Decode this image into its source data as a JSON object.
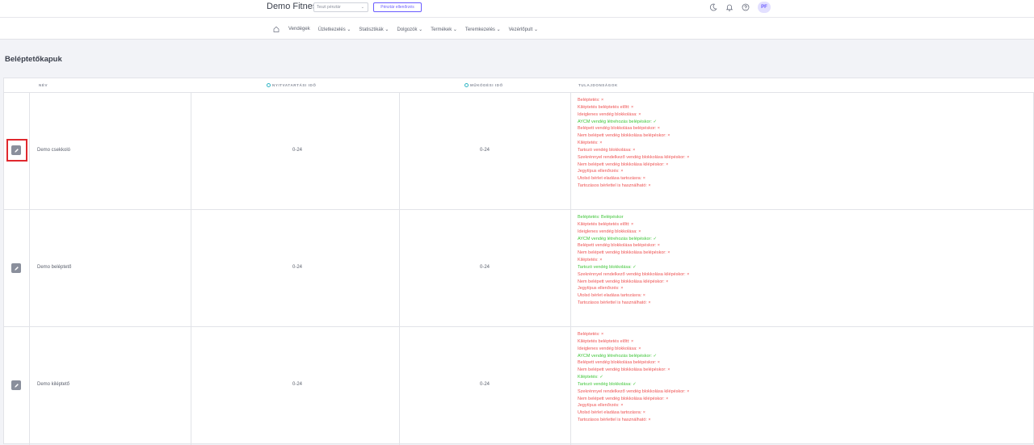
{
  "header": {
    "brand": "Demo Fitness",
    "register_select": "Teszt pénztár",
    "register_button": "Pénztár ellenőrzés",
    "avatar": "PF"
  },
  "nav": {
    "items": [
      {
        "label": "Vendégek"
      },
      {
        "label": "Üzletkezelés ⌄"
      },
      {
        "label": "Statisztikák ⌄"
      },
      {
        "label": "Dolgozók ⌄"
      },
      {
        "label": "Termékek ⌄"
      },
      {
        "label": "Teremkezelés ⌄"
      },
      {
        "label": "Vezérlőpult ⌄"
      }
    ]
  },
  "page": {
    "title": "Beléptetőkapuk"
  },
  "table": {
    "headers": {
      "name": "NÉV",
      "opening": "NYITVATARTÁSI IDŐ",
      "operating": "MŰKÖDÉSI IDŐ",
      "properties": "TULAJDONSÁGOK"
    },
    "rows": [
      {
        "name": "Demo csekkoló",
        "opening": "0-24",
        "operating": "0-24",
        "properties": [
          {
            "text": "Beléptetés: ×",
            "ok": false
          },
          {
            "text": "Kiléptetés beléptetés előtt: ×",
            "ok": false
          },
          {
            "text": "Ideiglenes vendég blokkolása: ×",
            "ok": false
          },
          {
            "text": "AYCM vendég létrehozás belépéskor: ✓",
            "ok": true
          },
          {
            "text": "Belépett vendég blokkolása belépéskor: ×",
            "ok": false
          },
          {
            "text": "Nem belépett vendég blokkolása belépéskor: ×",
            "ok": false
          },
          {
            "text": "Kiléptetés: ×",
            "ok": false
          },
          {
            "text": "Tartozó vendég blokkolása: ×",
            "ok": false
          },
          {
            "text": "Szekrénnyel rendelkező vendég blokkolása kilépéskor: ×",
            "ok": false
          },
          {
            "text": "Nem belépett vendég blokkolása kilépéskor: ×",
            "ok": false
          },
          {
            "text": "Jegytípus ellenőrzés: ×",
            "ok": false
          },
          {
            "text": "Utolsó bérlet eladása tartozásra: ×",
            "ok": false
          },
          {
            "text": "Tartozásos bérlettel is használható: ×",
            "ok": false
          }
        ]
      },
      {
        "name": "Demo beléptető",
        "opening": "0-24",
        "operating": "0-24",
        "properties": [
          {
            "text": "Beléptetés: Belépéskor",
            "ok": true
          },
          {
            "text": "Kiléptetés beléptetés előtt: ×",
            "ok": false
          },
          {
            "text": "Ideiglenes vendég blokkolása: ×",
            "ok": false
          },
          {
            "text": "AYCM vendég létrehozás belépéskor: ✓",
            "ok": true
          },
          {
            "text": "Belépett vendég blokkolása belépéskor: ×",
            "ok": false
          },
          {
            "text": "Nem belépett vendég blokkolása belépéskor: ×",
            "ok": false
          },
          {
            "text": "Kiléptetés: ×",
            "ok": false
          },
          {
            "text": "Tartozó vendég blokkolása: ✓",
            "ok": true
          },
          {
            "text": "Szekrénnyel rendelkező vendég blokkolása kilépéskor: ×",
            "ok": false
          },
          {
            "text": "Nem belépett vendég blokkolása kilépéskor: ×",
            "ok": false
          },
          {
            "text": "Jegytípus ellenőrzés: ×",
            "ok": false
          },
          {
            "text": "Utolsó bérlet eladása tartozásra: ×",
            "ok": false
          },
          {
            "text": "Tartozásos bérlettel is használható: ×",
            "ok": false
          }
        ]
      },
      {
        "name": "Demo kiléptető",
        "opening": "0-24",
        "operating": "0-24",
        "properties": [
          {
            "text": "Beléptetés: ×",
            "ok": false
          },
          {
            "text": "Kiléptetés beléptetés előtt: ×",
            "ok": false
          },
          {
            "text": "Ideiglenes vendég blokkolása: ×",
            "ok": false
          },
          {
            "text": "AYCM vendég létrehozás belépéskor: ✓",
            "ok": true
          },
          {
            "text": "Belépett vendég blokkolása belépéskor: ×",
            "ok": false
          },
          {
            "text": "Nem belépett vendég blokkolása belépéskor: ×",
            "ok": false
          },
          {
            "text": "Kiléptetés: ✓",
            "ok": true
          },
          {
            "text": "Tartozó vendég blokkolása: ✓",
            "ok": true
          },
          {
            "text": "Szekrénnyel rendelkező vendég blokkolása kilépéskor: ×",
            "ok": false
          },
          {
            "text": "Nem belépett vendég blokkolása kilépéskor: ×",
            "ok": false
          },
          {
            "text": "Jegytípus ellenőrzés: ×",
            "ok": false
          },
          {
            "text": "Utolsó bérlet eladása tartozásra: ×",
            "ok": false
          },
          {
            "text": "Tartozásos bérlettel is használható: ×",
            "ok": false
          }
        ]
      }
    ]
  },
  "colors": {
    "accent": "#6a5cff",
    "negative": "#ee5353",
    "positive": "#40c63a",
    "highlight": "#e0282e"
  }
}
